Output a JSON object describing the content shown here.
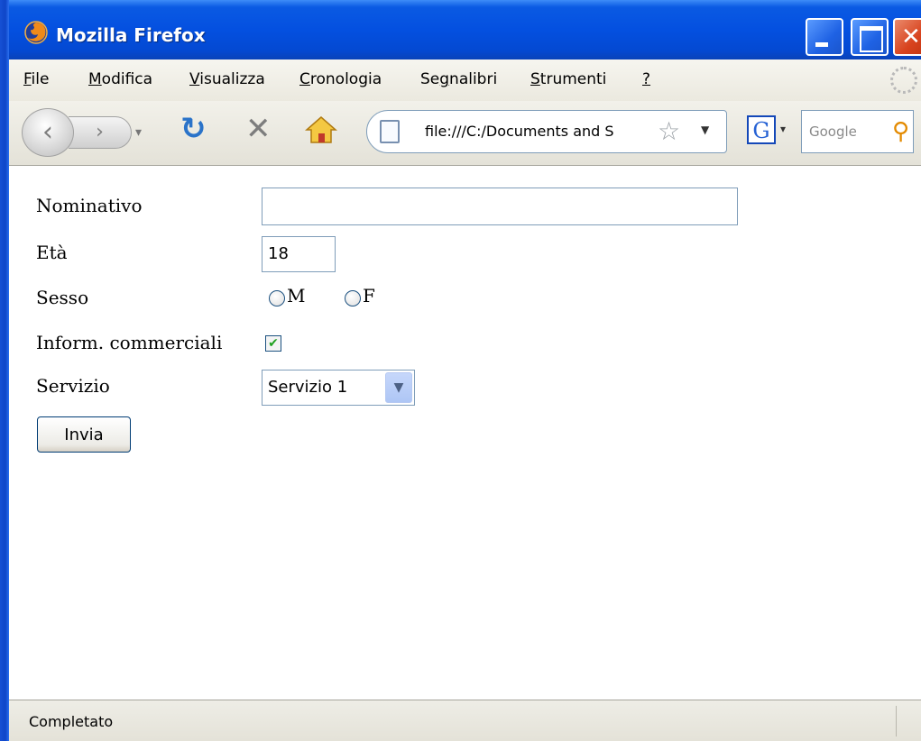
{
  "window": {
    "title": "Mozilla Firefox"
  },
  "menubar": {
    "items": [
      {
        "accel": "F",
        "rest": "ile"
      },
      {
        "accel": "M",
        "rest": "odifica"
      },
      {
        "accel": "V",
        "rest": "isualizza"
      },
      {
        "accel": "C",
        "rest": "ronologia"
      },
      {
        "prefix": "Se",
        "accel": "g",
        "rest": "nalibri"
      },
      {
        "accel": "S",
        "rest": "trumenti"
      },
      {
        "accel": "?",
        "rest": ""
      }
    ]
  },
  "navbar": {
    "url": "file:///C:/Documents and S",
    "search_placeholder": "Google"
  },
  "form": {
    "name_label": "Nominativo",
    "name_value": "",
    "age_label": "Età",
    "age_value": "18",
    "sex_label": "Sesso",
    "sex_option_m": "M",
    "sex_option_f": "F",
    "info_label": "Inform. commerciali",
    "info_checked": true,
    "service_label": "Servizio",
    "service_value": "Servizio 1",
    "submit_label": "Invia"
  },
  "statusbar": {
    "text": "Completato"
  },
  "colors": {
    "titlebar": "#0450e0",
    "chrome": "#ebe9df",
    "input_border": "#7f9db9"
  },
  "icons": [
    "firefox-icon",
    "back-icon",
    "forward-icon",
    "reload-icon",
    "stop-icon",
    "home-icon",
    "page-icon",
    "star-icon",
    "google-icon",
    "search-icon"
  ]
}
